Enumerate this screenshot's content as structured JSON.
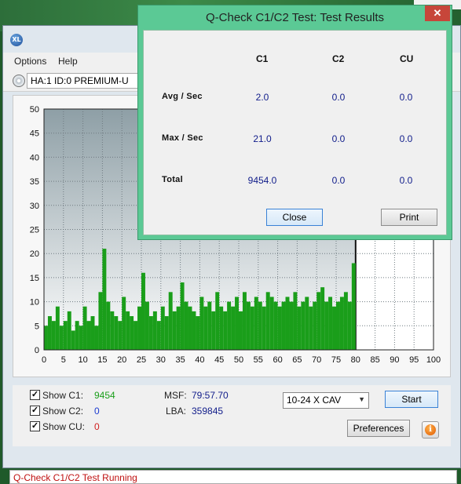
{
  "menu": {
    "options": "Options",
    "help": "Help"
  },
  "drive": {
    "selected": "HA:1 ID:0  PREMIUM-U"
  },
  "chart_data": {
    "type": "bar",
    "xlim": [
      0,
      100
    ],
    "ylim": [
      0,
      50
    ],
    "x_ticks": [
      0,
      5,
      10,
      15,
      20,
      25,
      30,
      35,
      40,
      45,
      50,
      55,
      60,
      65,
      70,
      75,
      80,
      85,
      90,
      95,
      100
    ],
    "y_ticks": [
      0,
      5,
      10,
      15,
      20,
      25,
      30,
      35,
      40,
      45,
      50
    ],
    "grid": true,
    "data_end_x": 80,
    "series": [
      {
        "color": "#1a9e1a",
        "x": [
          0.5,
          1.5,
          2.5,
          3.5,
          4.5,
          5.5,
          6.5,
          7.5,
          8.5,
          9.5,
          10.5,
          11.5,
          12.5,
          13.5,
          14.5,
          15.5,
          16.5,
          17.5,
          18.5,
          19.5,
          20.5,
          21.5,
          22.5,
          23.5,
          24.5,
          25.5,
          26.5,
          27.5,
          28.5,
          29.5,
          30.5,
          31.5,
          32.5,
          33.5,
          34.5,
          35.5,
          36.5,
          37.5,
          38.5,
          39.5,
          40.5,
          41.5,
          42.5,
          43.5,
          44.5,
          45.5,
          46.5,
          47.5,
          48.5,
          49.5,
          50.5,
          51.5,
          52.5,
          53.5,
          54.5,
          55.5,
          56.5,
          57.5,
          58.5,
          59.5,
          60.5,
          61.5,
          62.5,
          63.5,
          64.5,
          65.5,
          66.5,
          67.5,
          68.5,
          69.5,
          70.5,
          71.5,
          72.5,
          73.5,
          74.5,
          75.5,
          76.5,
          77.5,
          78.5,
          79.5
        ],
        "y": [
          5,
          7,
          6,
          9,
          5,
          6,
          8,
          4,
          6,
          5,
          9,
          6,
          7,
          5,
          12,
          21,
          10,
          8,
          7,
          6,
          11,
          8,
          7,
          6,
          9,
          16,
          10,
          7,
          8,
          6,
          9,
          7,
          12,
          8,
          9,
          14,
          10,
          9,
          8,
          7,
          11,
          9,
          10,
          8,
          12,
          9,
          8,
          10,
          9,
          11,
          8,
          12,
          10,
          9,
          11,
          10,
          9,
          12,
          11,
          10,
          9,
          10,
          11,
          10,
          12,
          9,
          10,
          11,
          9,
          10,
          12,
          13,
          10,
          11,
          9,
          10,
          11,
          12,
          10,
          18
        ]
      }
    ]
  },
  "controls": {
    "show_c1_label": "Show C1:",
    "show_c1_value": "9454",
    "show_c2_label": "Show C2:",
    "show_c2_value": "0",
    "show_cu_label": "Show CU:",
    "show_cu_value": "0",
    "msf_label": "MSF:",
    "msf_value": "79:57.70",
    "lba_label": "LBA:",
    "lba_value": "359845",
    "speed": "10-24 X CAV",
    "start": "Start",
    "preferences": "Preferences",
    "check_mark": "✓",
    "help_glyph": "i",
    "c1_color": "#1a9e1a",
    "c2_color": "#1a3ad0",
    "cu_color": "#d02020"
  },
  "status": {
    "text": "Q-Check C1/C2 Test Running"
  },
  "dialog": {
    "title": "Q-Check C1/C2 Test: Test Results",
    "close_x": "✕",
    "col_c1": "C1",
    "col_c2": "C2",
    "col_cu": "CU",
    "row_avg": "Avg / Sec",
    "row_max": "Max / Sec",
    "row_total": "Total",
    "avg_c1": "2.0",
    "avg_c2": "0.0",
    "avg_cu": "0.0",
    "max_c1": "21.0",
    "max_c2": "0.0",
    "max_cu": "0.0",
    "total_c1": "9454.0",
    "total_c2": "0.0",
    "total_cu": "0.0",
    "close_button": "Close",
    "print_button": "Print"
  }
}
